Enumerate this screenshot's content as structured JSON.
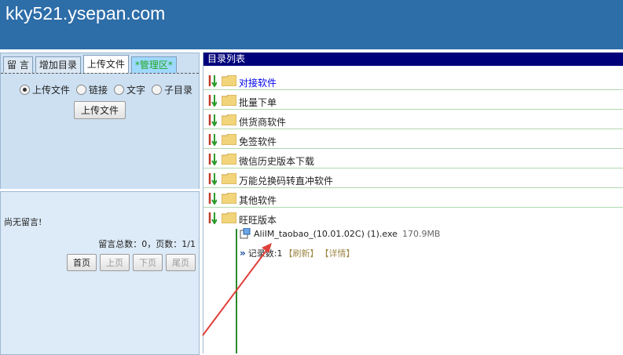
{
  "site": {
    "title": "kky521.ysepan.com"
  },
  "tabs": [
    {
      "label": "留 言",
      "active": false
    },
    {
      "label": "增加目录",
      "active": false
    },
    {
      "label": "上传文件",
      "active": true
    },
    {
      "label": "*管理区*",
      "active": false
    }
  ],
  "upload": {
    "options": [
      {
        "label": "上传文件",
        "checked": true
      },
      {
        "label": "链接",
        "checked": false
      },
      {
        "label": "文字",
        "checked": false
      },
      {
        "label": "子目录",
        "checked": false
      }
    ],
    "button_label": "上传文件"
  },
  "messages": {
    "empty_text": "尚无留言!",
    "stats": "留言总数：0，页数：1/1",
    "pager": {
      "first": "首页",
      "prev": "上页",
      "next": "下页",
      "last": "尾页"
    }
  },
  "directory": {
    "header": "目录列表",
    "folders": [
      {
        "name": "对接软件",
        "highlight": true
      },
      {
        "name": "批量下单",
        "highlight": false
      },
      {
        "name": "供货商软件",
        "highlight": false
      },
      {
        "name": "免签软件",
        "highlight": false
      },
      {
        "name": "微信历史版本下载",
        "highlight": false
      },
      {
        "name": "万能兑换码转直冲软件",
        "highlight": false
      },
      {
        "name": "其他软件",
        "highlight": false
      },
      {
        "name": "旺旺版本",
        "highlight": false
      }
    ],
    "file": {
      "name": "AliIM_taobao_(10.01.02C) (1).exe",
      "size": "170.9MB"
    },
    "record": {
      "label": "记录数:1",
      "refresh": "【刷新】",
      "detail": "【详情】"
    }
  },
  "colors": {
    "header_bg": "#2d6da8",
    "list_header_bg": "#00007a",
    "annotation_arrow": "#e0403a"
  }
}
